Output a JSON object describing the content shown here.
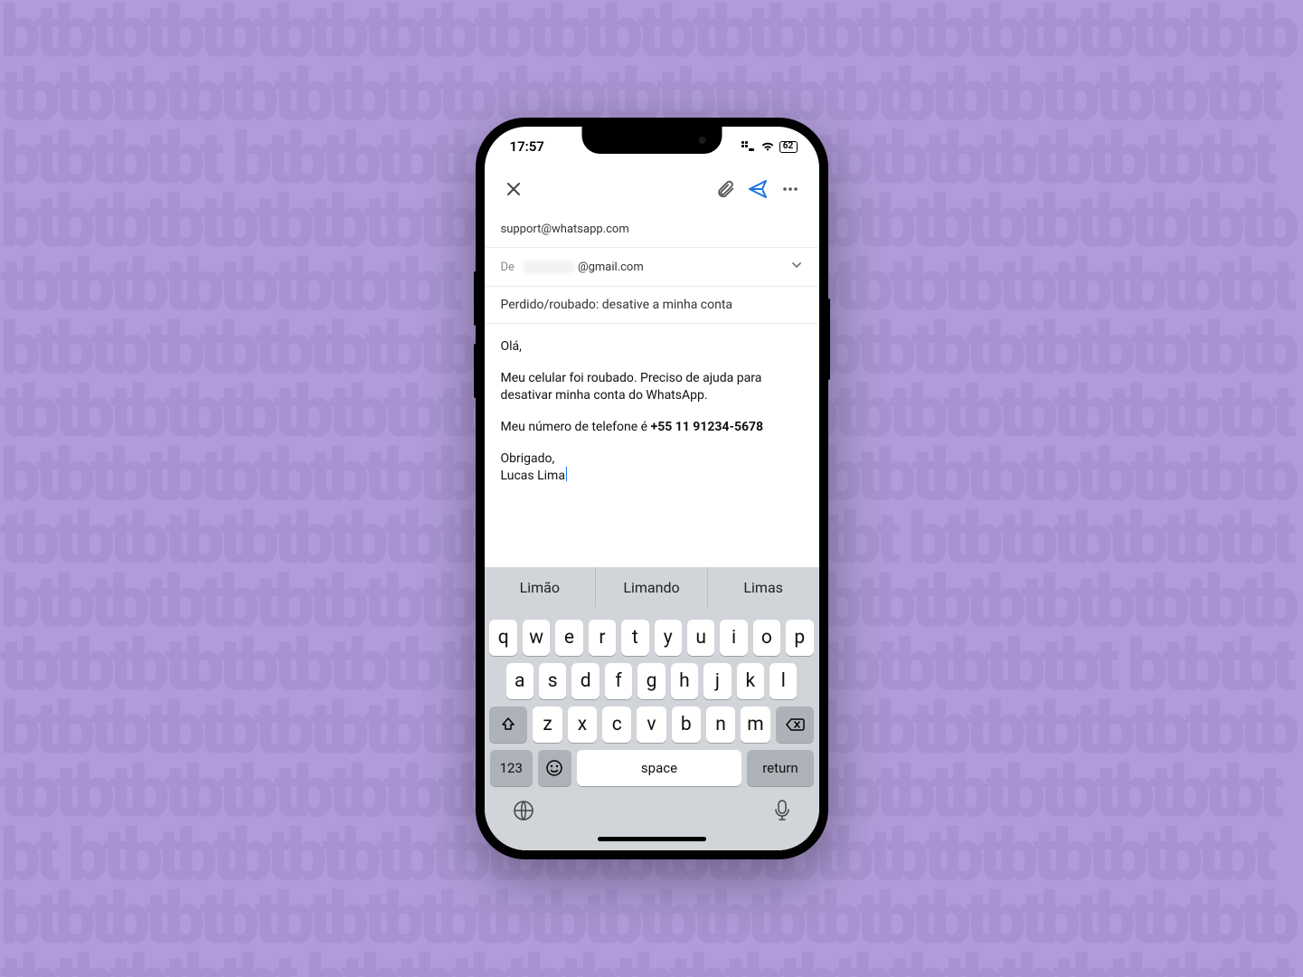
{
  "status": {
    "time": "17:57",
    "battery": "62"
  },
  "compose": {
    "to": "support@whatsapp.com",
    "from_label": "De",
    "from_domain": "@gmail.com",
    "subject": "Perdido/roubado: desative a minha conta",
    "greeting": "Olá,",
    "para1": "Meu celular foi roubado. Preciso de ajuda para desativar minha conta do WhatsApp.",
    "para2_prefix": "Meu número de telefone é ",
    "phone": "+55 11 91234-5678",
    "signoff": "Obrigado,",
    "name": "Lucas Lima"
  },
  "suggestions": [
    "Limão",
    "Limando",
    "Limas"
  ],
  "keyboard": {
    "row1": [
      "q",
      "w",
      "e",
      "r",
      "t",
      "y",
      "u",
      "i",
      "o",
      "p"
    ],
    "row2": [
      "a",
      "s",
      "d",
      "f",
      "g",
      "h",
      "j",
      "k",
      "l"
    ],
    "row3": [
      "z",
      "x",
      "c",
      "v",
      "b",
      "n",
      "m"
    ],
    "numbers": "123",
    "space": "space",
    "return": "return"
  }
}
